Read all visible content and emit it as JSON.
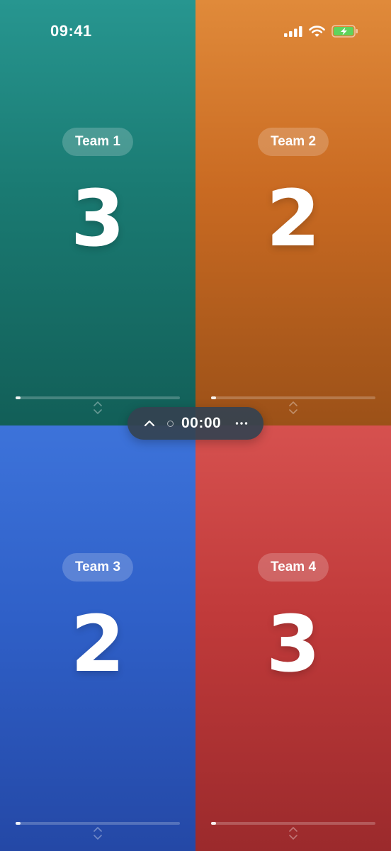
{
  "status_bar": {
    "time": "09:41"
  },
  "teams": [
    {
      "name": "Team 1",
      "score": "3",
      "color": "#1f8a82",
      "progress": 0.03
    },
    {
      "name": "Team 2",
      "score": "2",
      "color": "#d2762c",
      "progress": 0.03
    },
    {
      "name": "Team 3",
      "score": "2",
      "color": "#3366d0",
      "progress": 0.03
    },
    {
      "name": "Team 4",
      "score": "3",
      "color": "#c84243",
      "progress": 0.03
    }
  ],
  "timer": {
    "value": "00:00"
  }
}
